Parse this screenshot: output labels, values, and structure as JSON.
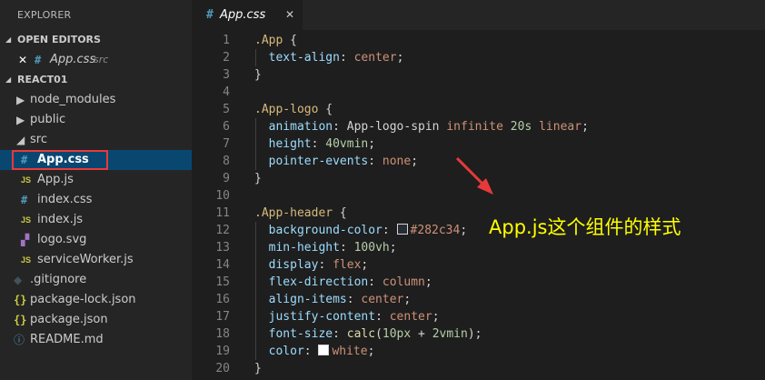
{
  "sidebar": {
    "title": "EXPLORER",
    "open_editors": {
      "header": "OPEN EDITORS",
      "items": [
        {
          "close": "✕",
          "icon": "#",
          "label": "App.css",
          "folder": "src"
        }
      ]
    },
    "project": {
      "header": "REACT01",
      "items": [
        {
          "label": "node_modules",
          "kind": "folder-closed"
        },
        {
          "label": "public",
          "kind": "folder-closed"
        },
        {
          "label": "src",
          "kind": "folder-open"
        },
        {
          "label": "App.css",
          "kind": "css",
          "selected": true
        },
        {
          "label": "App.js",
          "kind": "js"
        },
        {
          "label": "index.css",
          "kind": "css"
        },
        {
          "label": "index.js",
          "kind": "js"
        },
        {
          "label": "logo.svg",
          "kind": "svg"
        },
        {
          "label": "serviceWorker.js",
          "kind": "js"
        },
        {
          "label": ".gitignore",
          "kind": "git"
        },
        {
          "label": "package-lock.json",
          "kind": "json"
        },
        {
          "label": "package.json",
          "kind": "json"
        },
        {
          "label": "README.md",
          "kind": "info"
        }
      ]
    }
  },
  "editor": {
    "tab": {
      "icon": "#",
      "label": "App.css",
      "close": "✕"
    },
    "lines": [
      {
        "n": "1",
        "tokens": [
          [
            "sel",
            ".App"
          ],
          [
            "",
            " {"
          ]
        ]
      },
      {
        "n": "2",
        "tokens": [
          [
            "",
            "  "
          ],
          [
            "prop",
            "text-align"
          ],
          [
            "",
            ": "
          ],
          [
            "val",
            "center"
          ],
          [
            "",
            ";"
          ]
        ]
      },
      {
        "n": "3",
        "tokens": [
          [
            "",
            "}"
          ]
        ]
      },
      {
        "n": "4",
        "tokens": []
      },
      {
        "n": "5",
        "tokens": [
          [
            "sel",
            ".App-logo"
          ],
          [
            "",
            " {"
          ]
        ]
      },
      {
        "n": "6",
        "tokens": [
          [
            "",
            "  "
          ],
          [
            "prop",
            "animation"
          ],
          [
            "",
            ": "
          ],
          [
            "",
            "App-logo-spin "
          ],
          [
            "val",
            "infinite"
          ],
          [
            "",
            " "
          ],
          [
            "num-v",
            "20s"
          ],
          [
            "",
            " "
          ],
          [
            "val",
            "linear"
          ],
          [
            "",
            ";"
          ]
        ]
      },
      {
        "n": "7",
        "tokens": [
          [
            "",
            "  "
          ],
          [
            "prop",
            "height"
          ],
          [
            "",
            ": "
          ],
          [
            "num-v",
            "40vmin"
          ],
          [
            "",
            ";"
          ]
        ]
      },
      {
        "n": "8",
        "tokens": [
          [
            "",
            "  "
          ],
          [
            "prop",
            "pointer-events"
          ],
          [
            "",
            ": "
          ],
          [
            "val",
            "none"
          ],
          [
            "",
            ";"
          ]
        ]
      },
      {
        "n": "9",
        "tokens": [
          [
            "",
            "}"
          ]
        ]
      },
      {
        "n": "10",
        "tokens": []
      },
      {
        "n": "11",
        "tokens": [
          [
            "sel",
            ".App-header"
          ],
          [
            "",
            " {"
          ]
        ]
      },
      {
        "n": "12",
        "tokens": [
          [
            "",
            "  "
          ],
          [
            "prop",
            "background-color"
          ],
          [
            "",
            ": "
          ],
          [
            "swatch",
            "#282c34"
          ],
          [
            "val",
            "#282c34"
          ],
          [
            "",
            ";"
          ]
        ]
      },
      {
        "n": "13",
        "tokens": [
          [
            "",
            "  "
          ],
          [
            "prop",
            "min-height"
          ],
          [
            "",
            ": "
          ],
          [
            "num-v",
            "100vh"
          ],
          [
            "",
            ";"
          ]
        ]
      },
      {
        "n": "14",
        "tokens": [
          [
            "",
            "  "
          ],
          [
            "prop",
            "display"
          ],
          [
            "",
            ": "
          ],
          [
            "val",
            "flex"
          ],
          [
            "",
            ";"
          ]
        ]
      },
      {
        "n": "15",
        "tokens": [
          [
            "",
            "  "
          ],
          [
            "prop",
            "flex-direction"
          ],
          [
            "",
            ": "
          ],
          [
            "val",
            "column"
          ],
          [
            "",
            ";"
          ]
        ]
      },
      {
        "n": "16",
        "tokens": [
          [
            "",
            "  "
          ],
          [
            "prop",
            "align-items"
          ],
          [
            "",
            ": "
          ],
          [
            "val",
            "center"
          ],
          [
            "",
            ";"
          ]
        ]
      },
      {
        "n": "17",
        "tokens": [
          [
            "",
            "  "
          ],
          [
            "prop",
            "justify-content"
          ],
          [
            "",
            ": "
          ],
          [
            "val",
            "center"
          ],
          [
            "",
            ";"
          ]
        ]
      },
      {
        "n": "18",
        "tokens": [
          [
            "",
            "  "
          ],
          [
            "prop",
            "font-size"
          ],
          [
            "",
            ": "
          ],
          [
            "fn",
            "calc"
          ],
          [
            "",
            "("
          ],
          [
            "num-v",
            "10px"
          ],
          [
            "",
            " + "
          ],
          [
            "num-v",
            "2vmin"
          ],
          [
            "",
            ");"
          ]
        ]
      },
      {
        "n": "19",
        "tokens": [
          [
            "",
            "  "
          ],
          [
            "prop",
            "color"
          ],
          [
            "",
            ": "
          ],
          [
            "swatch",
            "#ffffff"
          ],
          [
            "val",
            "white"
          ],
          [
            "",
            ";"
          ]
        ]
      },
      {
        "n": "20",
        "tokens": [
          [
            "",
            "}"
          ]
        ]
      }
    ]
  },
  "annotation": {
    "text": "App.js这个组件的样式",
    "color": "#ffff00"
  },
  "colors": {
    "selection": "#094771",
    "highlight_box": "#e8393a",
    "arrow": "#e8393a"
  }
}
